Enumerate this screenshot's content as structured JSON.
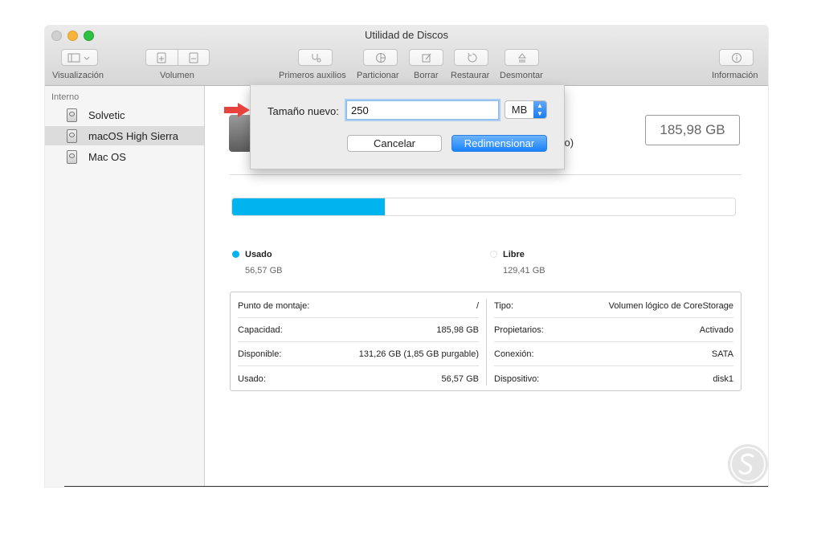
{
  "window": {
    "title": "Utilidad de Discos"
  },
  "toolbar": {
    "view_label": "Visualización",
    "volume_label": "Volumen",
    "first_aid_label": "Primeros auxilios",
    "partition_label": "Particionar",
    "erase_label": "Borrar",
    "restore_label": "Restaurar",
    "unmount_label": "Desmontar",
    "info_label": "Información"
  },
  "sidebar": {
    "section": "Interno",
    "items": [
      {
        "label": "Solvetic",
        "selected": false
      },
      {
        "label": "macOS High Sierra",
        "selected": true
      },
      {
        "label": "Mac OS",
        "selected": false
      }
    ]
  },
  "volume": {
    "partial_text": "gistro)",
    "size": "185,98 GB",
    "usage_fraction": 0.304
  },
  "legend": {
    "used_label": "Usado",
    "used_value": "56,57 GB",
    "used_color": "#00b4ef",
    "free_label": "Libre",
    "free_value": "129,41 GB"
  },
  "info_left": [
    {
      "label": "Punto de montaje:",
      "value": "/"
    },
    {
      "label": "Capacidad:",
      "value": "185,98 GB"
    },
    {
      "label": "Disponible:",
      "value": "131,26 GB (1,85 GB purgable)"
    },
    {
      "label": "Usado:",
      "value": "56,57 GB"
    }
  ],
  "info_right": [
    {
      "label": "Tipo:",
      "value": "Volumen lógico de CoreStorage"
    },
    {
      "label": "Propietarios:",
      "value": "Activado"
    },
    {
      "label": "Conexión:",
      "value": "SATA"
    },
    {
      "label": "Dispositivo:",
      "value": "disk1"
    }
  ],
  "dialog": {
    "label": "Tamaño nuevo:",
    "value": "250",
    "unit": "MB",
    "cancel": "Cancelar",
    "confirm": "Redimensionar"
  }
}
